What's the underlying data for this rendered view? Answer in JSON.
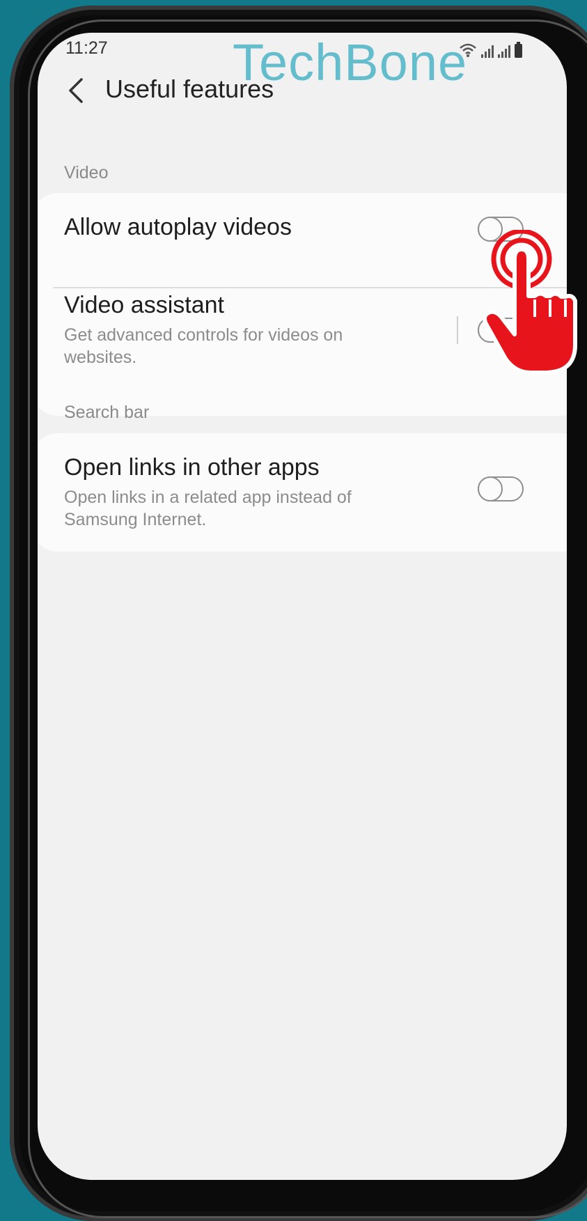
{
  "status_bar": {
    "time": "11:27"
  },
  "watermark": "TechBone",
  "header": {
    "title": "Useful features"
  },
  "sections": [
    {
      "label": "Video",
      "items": [
        {
          "title": "Allow autoplay videos",
          "subtitle": "",
          "toggle_on": false
        },
        {
          "title": "Video assistant",
          "subtitle": "Get advanced controls for videos on websites.",
          "toggle_on": false
        }
      ]
    },
    {
      "label": "Search bar",
      "items": [
        {
          "title": "Open links in other apps",
          "subtitle": "Open links in a related app instead of Samsung Internet.",
          "toggle_on": false
        }
      ]
    }
  ],
  "colors": {
    "background": "#12798a",
    "screen": "#f1f1f1",
    "card": "#fbfbfb",
    "accent": "#e8141c",
    "watermark": "#55b7c8"
  },
  "icons": {
    "back": "chevron-left-icon",
    "tap": "tap-hand-icon"
  }
}
